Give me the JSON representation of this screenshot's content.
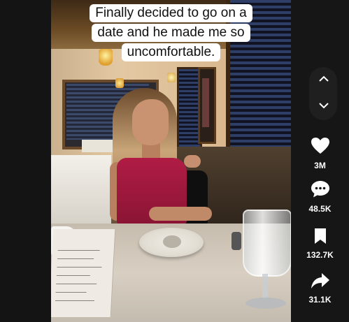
{
  "caption": {
    "lines": [
      "Finally decided to go on a",
      "date and he made me so",
      "uncomfortable."
    ]
  },
  "actions": {
    "likes": "3M",
    "comments": "48.5K",
    "saves": "132.7K",
    "shares": "31.1K"
  },
  "icons": {
    "prev": "chevron-up-icon",
    "next": "chevron-down-icon",
    "like": "heart-icon",
    "comment": "comment-icon",
    "save": "bookmark-icon",
    "share": "share-icon"
  }
}
